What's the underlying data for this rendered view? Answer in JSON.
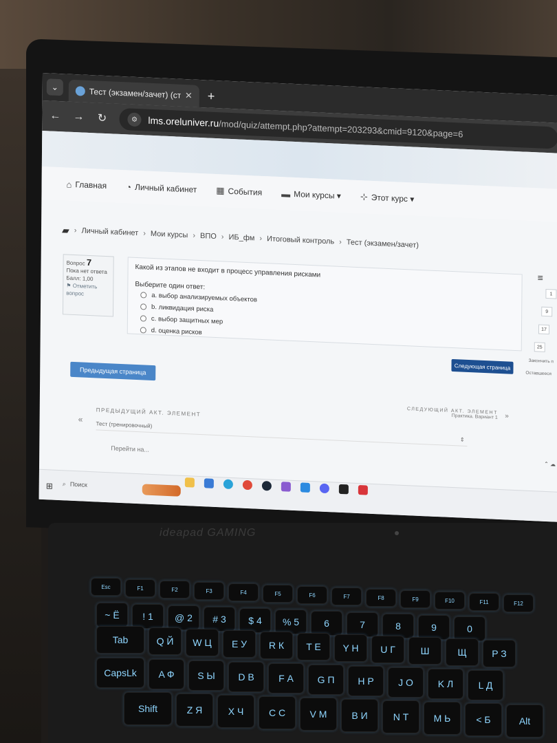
{
  "browser": {
    "tab_title": "Тест (экзамен/зачет) (страниц",
    "tab_close": "✕",
    "new_tab": "+",
    "url_host": "lms.oreluniver.ru",
    "url_path": "/mod/quiz/attempt.php?attempt=203293&cmid=9120&page=6"
  },
  "nav": {
    "items": [
      {
        "label": "Главная",
        "icon": "home-icon"
      },
      {
        "label": "Личный кабинет",
        "icon": "dashboard-icon"
      },
      {
        "label": "События",
        "icon": "calendar-icon"
      },
      {
        "label": "Мои курсы ▾",
        "icon": "briefcase-icon"
      },
      {
        "label": "Этот курс ▾",
        "icon": "sitemap-icon"
      }
    ]
  },
  "breadcrumb": [
    "Личный кабинет",
    "Мои курсы",
    "ВПО",
    "ИБ_фм",
    "Итоговый контроль",
    "Тест (экзамен/зачет)"
  ],
  "question": {
    "label": "Вопрос",
    "number": "7",
    "status": "Пока нет ответа",
    "score": "Балл: 1,00",
    "flag": "Отметить вопрос",
    "text": "Какой из этапов не входит в процесс управления рисками",
    "prompt": "Выберите один ответ:",
    "answers": [
      "a. выбор анализируемых объектов",
      "b. ликвидация риска",
      "c. выбор защитных мер",
      "d. оценка рисков"
    ]
  },
  "quiz_nav": {
    "menu": "≡",
    "cells": [
      "1",
      "9",
      "17",
      "25"
    ],
    "finish": "Закончить п",
    "remaining": "Оставшееся"
  },
  "buttons": {
    "next_page": "Следующая страница",
    "prev_page": "Предыдущая страница"
  },
  "activity": {
    "next_label": "СЛЕДУЮЩИЙ АКТ. ЭЛЕМЕНТ",
    "next_name": "Практика. Вариант 1",
    "next_arrow": "»",
    "prev_label": "ПРЕДЫДУЩИЙ АКТ. ЭЛЕМЕНТ",
    "prev_name": "Тест (тренировочный)",
    "prev_arrow": "«",
    "jump_placeholder": "Перейти на..."
  },
  "taskbar": {
    "search_placeholder": "Поиск"
  },
  "keyboard": {
    "brand": "ideapad GAMING",
    "keys": [
      {
        "t": "Esc"
      },
      {
        "t": "F1"
      },
      {
        "t": "F2"
      },
      {
        "t": "F3"
      },
      {
        "t": "F4"
      },
      {
        "t": "F5"
      },
      {
        "t": "F6"
      },
      {
        "t": "F7"
      },
      {
        "t": "F8"
      },
      {
        "t": "F9"
      },
      {
        "t": "F10"
      },
      {
        "t": "F11"
      },
      {
        "t": "F12"
      },
      {
        "t": "~ Ё"
      },
      {
        "t": "! 1"
      },
      {
        "t": "@ 2"
      },
      {
        "t": "# 3"
      },
      {
        "t": "$ 4"
      },
      {
        "t": "% 5"
      },
      {
        "t": "6"
      },
      {
        "t": "7"
      },
      {
        "t": "8"
      },
      {
        "t": "9"
      },
      {
        "t": "0"
      },
      {
        "t": "Tab"
      },
      {
        "t": "Q Й"
      },
      {
        "t": "W Ц"
      },
      {
        "t": "E У"
      },
      {
        "t": "R К"
      },
      {
        "t": "T Е"
      },
      {
        "t": "Y Н"
      },
      {
        "t": "U Г"
      },
      {
        "t": "Ш"
      },
      {
        "t": "Щ"
      },
      {
        "t": "P З"
      },
      {
        "t": "CapsLk"
      },
      {
        "t": "A Ф"
      },
      {
        "t": "S Ы"
      },
      {
        "t": "D В"
      },
      {
        "t": "F А"
      },
      {
        "t": "G П"
      },
      {
        "t": "H Р"
      },
      {
        "t": "J О"
      },
      {
        "t": "K Л"
      },
      {
        "t": "L Д"
      },
      {
        "t": "Shift"
      },
      {
        "t": "Z Я"
      },
      {
        "t": "X Ч"
      },
      {
        "t": "C С"
      },
      {
        "t": "V М"
      },
      {
        "t": "B И"
      },
      {
        "t": "N Т"
      },
      {
        "t": "M Ь"
      },
      {
        "t": "< Б"
      },
      {
        "t": "Alt"
      }
    ]
  },
  "colors": {
    "next_button": "#1d4f91",
    "prev_button": "#4a86c8",
    "key_glow": "#8fd6ff"
  }
}
